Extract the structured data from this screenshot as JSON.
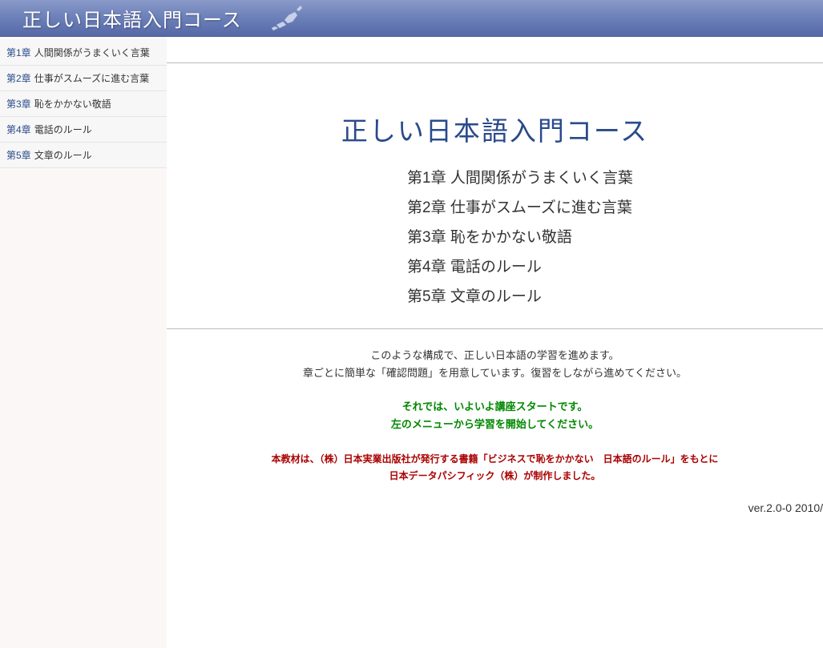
{
  "header": {
    "title": "正しい日本語入門コース"
  },
  "sidebar": {
    "items": [
      {
        "chapter": "第1章",
        "label": "人間関係がうまくいく言葉"
      },
      {
        "chapter": "第2章",
        "label": "仕事がスムーズに進む言葉"
      },
      {
        "chapter": "第3章",
        "label": "恥をかかない敬語"
      },
      {
        "chapter": "第4章",
        "label": "電話のルール"
      },
      {
        "chapter": "第5章",
        "label": "文章のルール"
      }
    ]
  },
  "main": {
    "title": "正しい日本語入門コース",
    "chapters": [
      "第1章 人間関係がうまくいく言葉",
      "第2章 仕事がスムーズに進む言葉",
      "第3章 恥をかかない敬語",
      "第4章 電話のルール",
      "第5章 文章のルール"
    ],
    "intro_line1": "このような構成で、正しい日本語の学習を進めます。",
    "intro_line2": "章ごとに簡単な「確認問題」を用意しています。復習をしながら進めてください。",
    "start_line1": "それでは、いよいよ講座スタートです。",
    "start_line2": "左のメニューから学習を開始してください。",
    "credit_line1": "本教材は、（株）日本実業出版社が発行する書籍「ビジネスで恥をかかない　日本語のルール」をもとに",
    "credit_line2": "日本データパシフィック（株）が制作しました。",
    "version": "ver.2.0-0 2010/"
  }
}
